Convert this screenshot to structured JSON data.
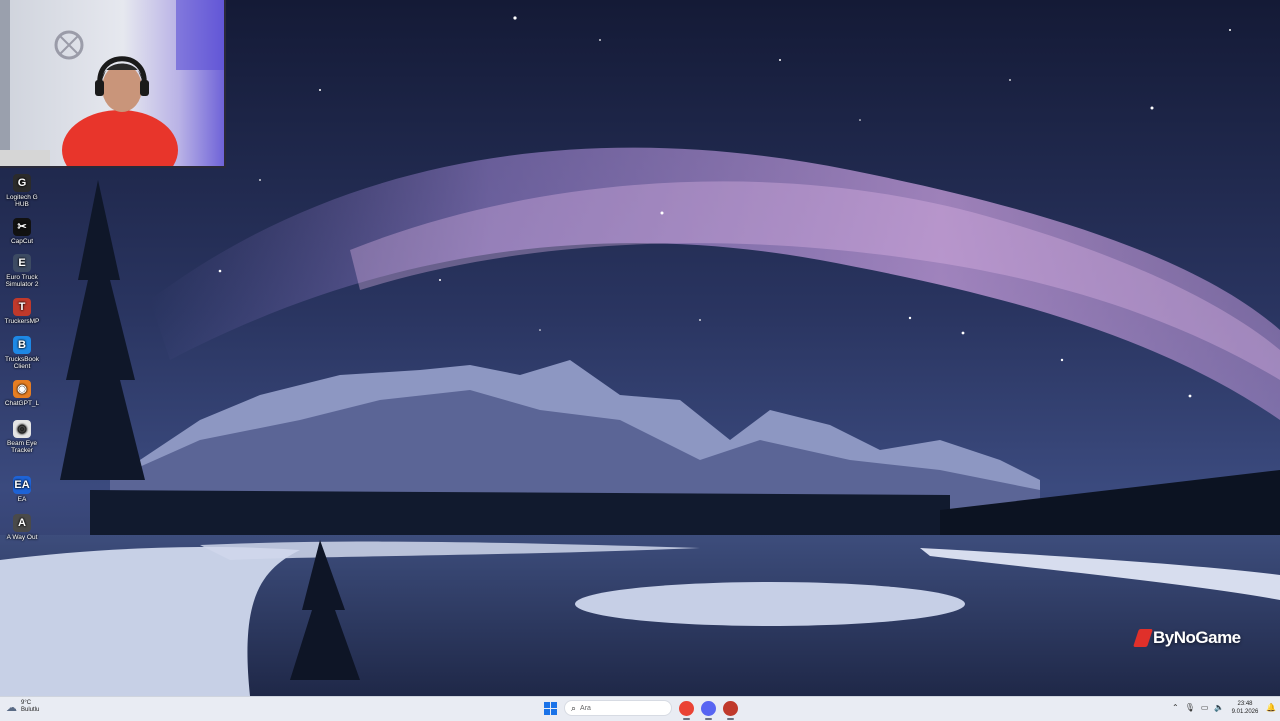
{
  "desktop": {
    "icons": [
      {
        "label": "Logitech G HUB",
        "icon": "logitech-g-hub-icon",
        "color": "#2b2b2b",
        "glyph": "G"
      },
      {
        "label": "CapCut",
        "icon": "capcut-icon",
        "color": "#111111",
        "glyph": "✂"
      },
      {
        "label": "Euro Truck Simulator 2",
        "icon": "euro-truck-simulator-icon",
        "color": "#3d4b63",
        "glyph": "E"
      },
      {
        "label": "TruckersMP",
        "icon": "truckersmp-icon",
        "color": "#c0392b",
        "glyph": "T"
      },
      {
        "label": "TrucksBook Client",
        "icon": "trucksbook-icon",
        "color": "#1e88e5",
        "glyph": "B"
      },
      {
        "label": "ChatGPT_L",
        "icon": "chatgpt-icon",
        "color": "#e67e22",
        "glyph": "◉"
      },
      {
        "label": "Beam Eye Tracker",
        "icon": "beam-eye-tracker-icon",
        "color": "#e5e5e5",
        "glyph": "◎"
      },
      {
        "label": "EA",
        "icon": "ea-icon",
        "color": "#1e63d6",
        "glyph": "EA"
      },
      {
        "label": "A Way Out",
        "icon": "a-way-out-icon",
        "color": "#4a4a4a",
        "glyph": "A"
      }
    ]
  },
  "watermark": {
    "text": "ByNoGame"
  },
  "taskbar": {
    "weather": {
      "temp": "9°C",
      "condition": "Bulutlu"
    },
    "search": {
      "placeholder": "Ara"
    },
    "apps": [
      {
        "name": "chrome",
        "icon": "chrome-icon",
        "color": "#ea4335"
      },
      {
        "name": "discord",
        "icon": "discord-icon",
        "color": "#5865f2"
      },
      {
        "name": "game",
        "icon": "game-app-icon",
        "color": "#c0392b"
      }
    ],
    "clock": {
      "time": "23:48",
      "date": "9.01.2026"
    }
  }
}
